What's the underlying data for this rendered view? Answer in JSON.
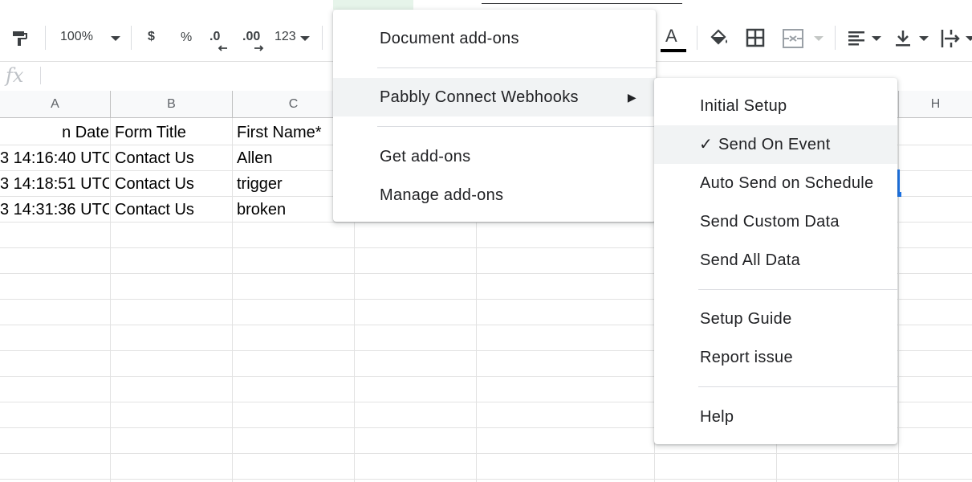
{
  "toolbar": {
    "paint_format_icon": "paint-format-icon",
    "zoom": "100%",
    "currency": "$",
    "percent": "%",
    "decrease_decimal": ".0",
    "increase_decimal": ".00",
    "more_formats": "123",
    "text_color_label": "A",
    "text_color": "#000000"
  },
  "formula_bar": {
    "fx": "fx"
  },
  "columns": [
    "A",
    "B",
    "C",
    "H"
  ],
  "rows": [
    [
      "n Date",
      "Form Title",
      "First Name*"
    ],
    [
      "3 14:16:40 UTC",
      "Contact Us",
      "Allen"
    ],
    [
      "3 14:18:51 UTC",
      "Contact Us",
      "trigger"
    ],
    [
      "3 14:31:36 UTC",
      "Contact Us",
      "broken"
    ]
  ],
  "addons_menu": {
    "items": [
      "Document add-ons",
      "Pabbly Connect Webhooks",
      "Get add-ons",
      "Manage add-ons"
    ],
    "submenu_arrow": "▶"
  },
  "submenu": {
    "items": [
      "Initial Setup",
      "Send On Event",
      "Auto Send on Schedule",
      "Send Custom Data",
      "Send All Data",
      "Setup Guide",
      "Report issue",
      "Help"
    ],
    "checkmark": "✓"
  }
}
